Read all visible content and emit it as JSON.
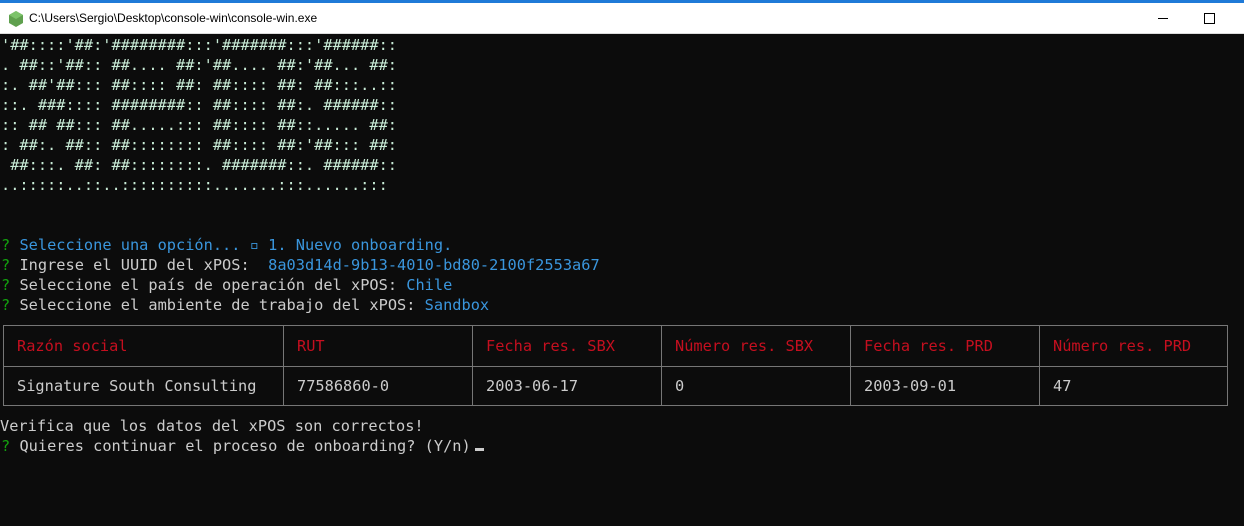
{
  "window": {
    "title": "C:\\Users\\Sergio\\Desktop\\console-win\\console-win.exe",
    "min_symbol": "",
    "max_symbol": ""
  },
  "banner": [
    "'##::::'##:'########:::'#######:::'######::",
    ". ##::'##:: ##.... ##:'##.... ##:'##... ##:",
    ":. ##'##::: ##:::: ##: ##:::: ##: ##:::..::",
    "::. ###:::: ########:: ##:::: ##:. ######::",
    ":: ## ##::: ##.....::: ##:::: ##::..... ##:",
    ": ##:. ##:: ##:::::::: ##:::: ##:'##::: ##:",
    " ##:::. ##: ##::::::::. #######::. ######::",
    "..:::::..::..::::::::::.......:::......:::"
  ],
  "prompts": [
    {
      "mark": "?",
      "label": "Seleccione una opción...",
      "arrow": "▫",
      "answer": "1. Nuevo onboarding."
    },
    {
      "mark": "?",
      "label": "Ingrese el UUID del xPOS:",
      "answer": "8a03d14d-9b13-4010-bd80-2100f2553a67"
    },
    {
      "mark": "?",
      "label": "Seleccione el país de operación del xPOS:",
      "answer": "Chile"
    },
    {
      "mark": "?",
      "label": "Seleccione el ambiente de trabajo del xPOS:",
      "answer": "Sandbox"
    }
  ],
  "table": {
    "headers": [
      "Razón social",
      "RUT",
      "Fecha res. SBX",
      "Número res. SBX",
      "Fecha res. PRD",
      "Número res. PRD"
    ],
    "rows": [
      [
        "Signature South Consulting",
        "77586860-0",
        "2003-06-17",
        "0",
        "2003-09-01",
        "47"
      ]
    ]
  },
  "verify_text": "Verifica que los datos del xPOS son correctos!",
  "confirm": {
    "mark": "?",
    "label": "Quieres continuar el proceso de onboarding?",
    "hint": "(Y/n)"
  },
  "colors": {
    "background": "#0c0c0c",
    "question_mark": "#13a10e",
    "answer": "#3a96dd",
    "table_header": "#c50f1f",
    "banner": "#c8ebd6"
  },
  "icons": {
    "app": "node-hexagon-icon"
  }
}
